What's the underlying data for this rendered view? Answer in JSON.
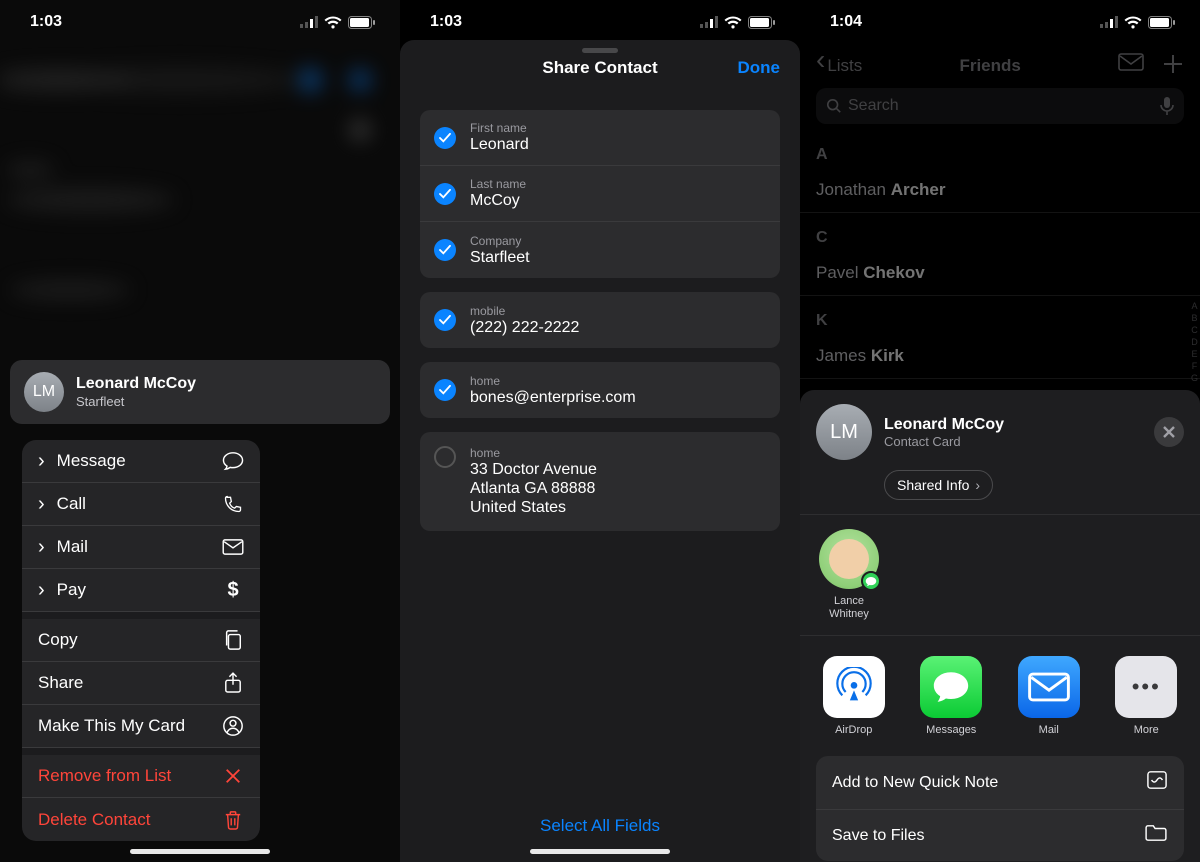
{
  "status": {
    "time1": "1:03",
    "time2": "1:03",
    "time3": "1:04"
  },
  "screen1": {
    "contact": {
      "initials": "LM",
      "name": "Leonard McCoy",
      "company": "Starfleet"
    },
    "menu": {
      "message": "Message",
      "call": "Call",
      "mail": "Mail",
      "pay": "Pay",
      "copy": "Copy",
      "share": "Share",
      "make_card": "Make This My Card",
      "remove": "Remove from List",
      "delete": "Delete Contact"
    }
  },
  "screen2": {
    "title": "Share Contact",
    "done": "Done",
    "fields": {
      "first_name": {
        "label": "First name",
        "value": "Leonard"
      },
      "last_name": {
        "label": "Last name",
        "value": "McCoy"
      },
      "company": {
        "label": "Company",
        "value": "Starfleet"
      },
      "mobile": {
        "label": "mobile",
        "value": "(222) 222-2222"
      },
      "email": {
        "label": "home",
        "value": "bones@enterprise.com"
      },
      "address": {
        "label": "home",
        "line1": "33 Doctor Avenue",
        "line2": "Atlanta GA 88888",
        "line3": "United States"
      }
    },
    "select_all": "Select All Fields"
  },
  "screen3": {
    "nav": {
      "back": "Lists",
      "title": "Friends"
    },
    "search_placeholder": "Search",
    "sections": {
      "A": {
        "header": "A",
        "first": "Jonathan",
        "last": "Archer"
      },
      "C": {
        "header": "C",
        "first": "Pavel",
        "last": "Chekov"
      },
      "K": {
        "header": "K",
        "first": "James",
        "last": "Kirk"
      }
    },
    "index": [
      "A",
      "B",
      "C",
      "D",
      "E",
      "F",
      "G"
    ],
    "share": {
      "initials": "LM",
      "name": "Leonard McCoy",
      "subtitle": "Contact Card",
      "shared_info": "Shared Info",
      "person_first": "Lance",
      "person_last": "Whitney",
      "apps": {
        "airdrop": "AirDrop",
        "messages": "Messages",
        "mail": "Mail",
        "more": "More"
      },
      "actions": {
        "quicknote": "Add to New Quick Note",
        "save": "Save to Files"
      }
    }
  }
}
